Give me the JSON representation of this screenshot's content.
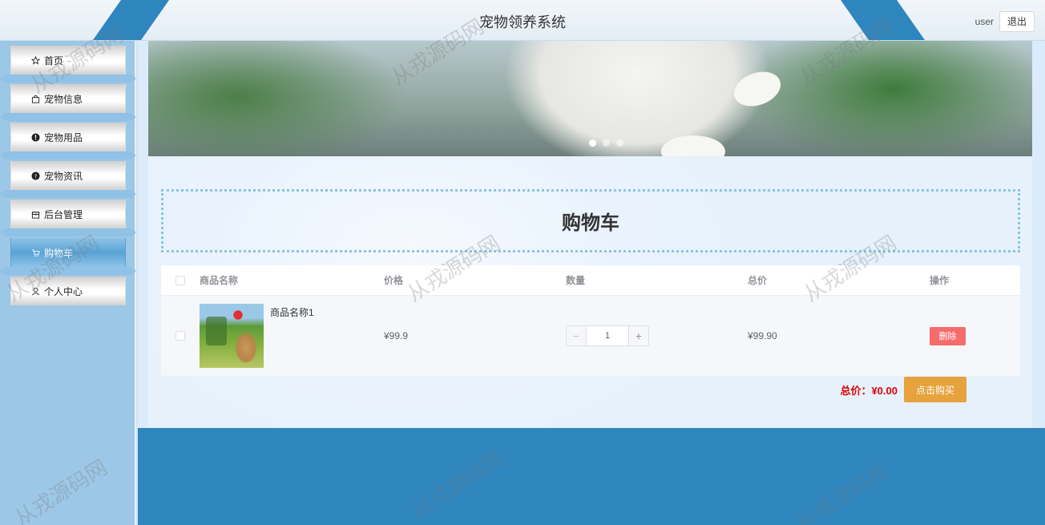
{
  "header": {
    "title": "宠物领养系统",
    "username": "user",
    "logout_label": "退出"
  },
  "sidebar": {
    "items": [
      {
        "label": "首页",
        "icon": "star-icon"
      },
      {
        "label": "宠物信息",
        "icon": "bag-icon"
      },
      {
        "label": "宠物用品",
        "icon": "alert-circle-icon"
      },
      {
        "label": "宠物资讯",
        "icon": "question-circle-icon"
      },
      {
        "label": "后台管理",
        "icon": "box-icon"
      },
      {
        "label": "购物车",
        "icon": "cart-icon",
        "active": true
      },
      {
        "label": "个人中心",
        "icon": "user-icon"
      }
    ]
  },
  "banner": {
    "slides": 3,
    "active_slide": 1
  },
  "cart": {
    "title": "购物车",
    "columns": [
      "商品名称",
      "价格",
      "数量",
      "总价",
      "操作"
    ],
    "rows": [
      {
        "name": "商品名称1",
        "price": "¥99.9",
        "quantity": "1",
        "total": "¥99.90",
        "delete_label": "删除"
      }
    ],
    "summary_label": "总价：¥0.00",
    "buy_label": "点击购买"
  },
  "watermark": "从戎源码网",
  "colors": {
    "accent": "#2f85bd",
    "sidebar_bg": "#9dc7e6",
    "delete": "#f56c6c",
    "buy": "#e6a23c",
    "total_text": "#e00000"
  }
}
